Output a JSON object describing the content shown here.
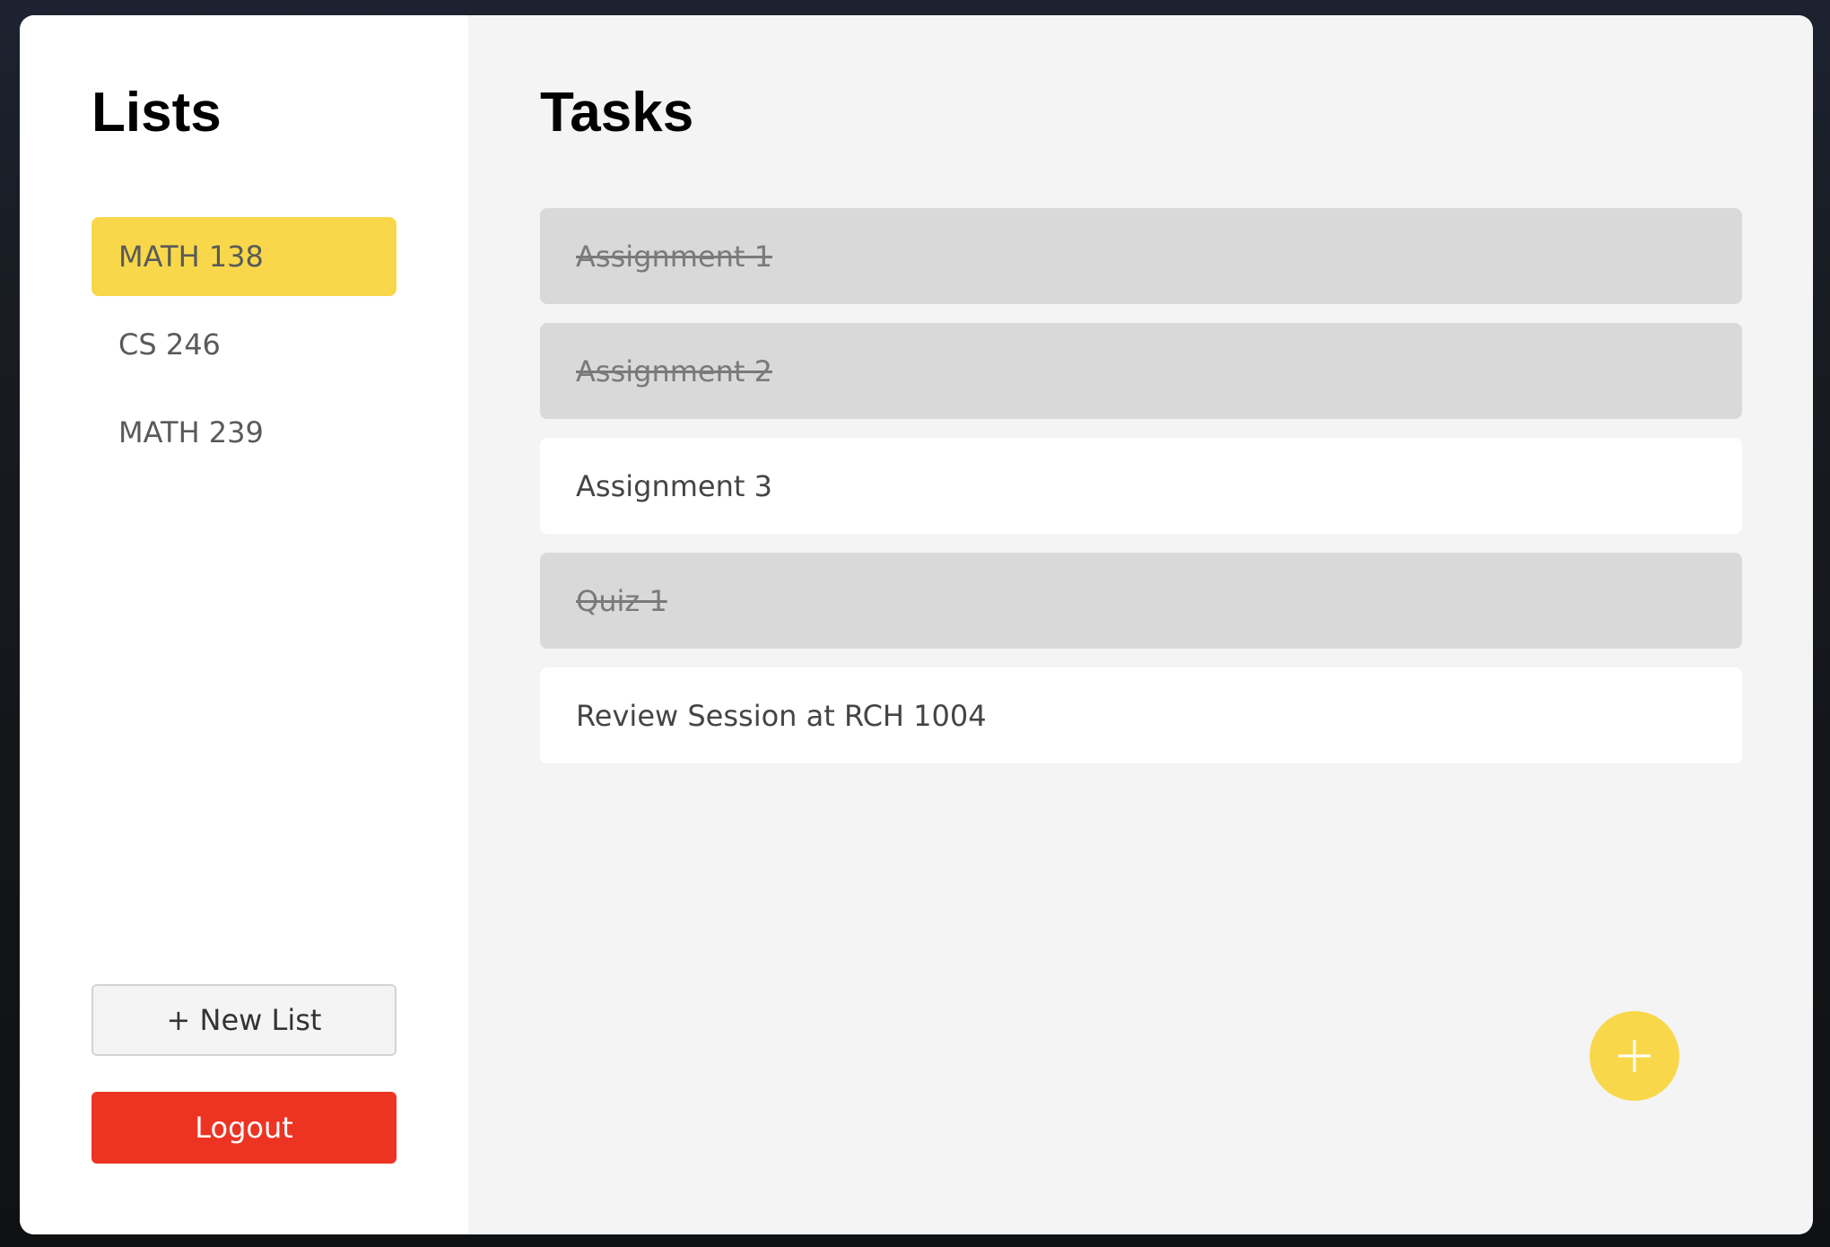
{
  "colors": {
    "accent": "#f8d84a",
    "danger": "#ed3423",
    "completed_task_bg": "#d9d9d9",
    "pending_task_bg": "#ffffff"
  },
  "sidebar": {
    "title": "Lists",
    "items": [
      {
        "label": "MATH 138",
        "active": true
      },
      {
        "label": "CS 246",
        "active": false
      },
      {
        "label": "MATH 239",
        "active": false
      }
    ],
    "new_list_label": "+ New List",
    "logout_label": "Logout"
  },
  "main": {
    "title": "Tasks",
    "tasks": [
      {
        "label": "Assignment 1",
        "completed": true
      },
      {
        "label": "Assignment 2",
        "completed": true
      },
      {
        "label": "Assignment 3",
        "completed": false
      },
      {
        "label": "Quiz 1",
        "completed": true
      },
      {
        "label": "Review Session at RCH 1004",
        "completed": false
      }
    ],
    "add_task_icon": "plus-icon"
  }
}
